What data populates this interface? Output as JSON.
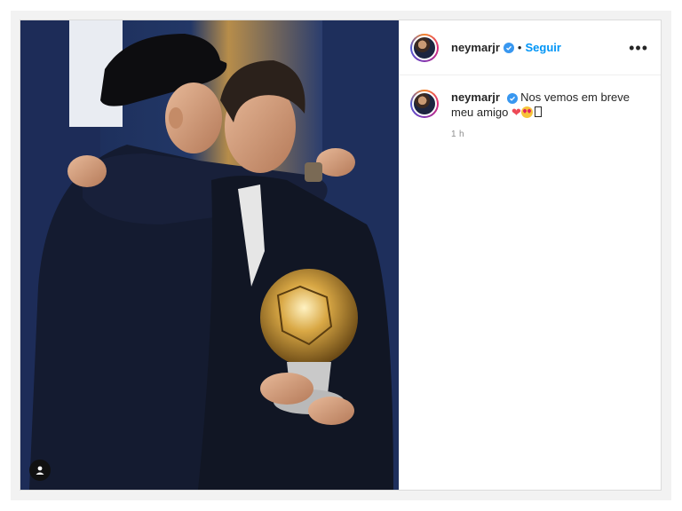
{
  "post": {
    "username": "neymarjr",
    "follow_label": "Seguir",
    "separator": "•",
    "more_label": "•••",
    "caption": {
      "username": "neymarjr",
      "text": "Nos vemos em breve meu amigo",
      "emojis": [
        "heart-emoji",
        "star-struck-emoji",
        "unrendered-glyph"
      ],
      "heart_glyph": "❤",
      "timestamp": "1 h"
    },
    "media": {
      "description_icons": [
        "user-tag-icon"
      ]
    }
  },
  "colors": {
    "link_blue": "#0095f6",
    "verified_blue": "#3897f0",
    "heart_red": "#ed4956",
    "muted_text": "#8e8e8e"
  }
}
